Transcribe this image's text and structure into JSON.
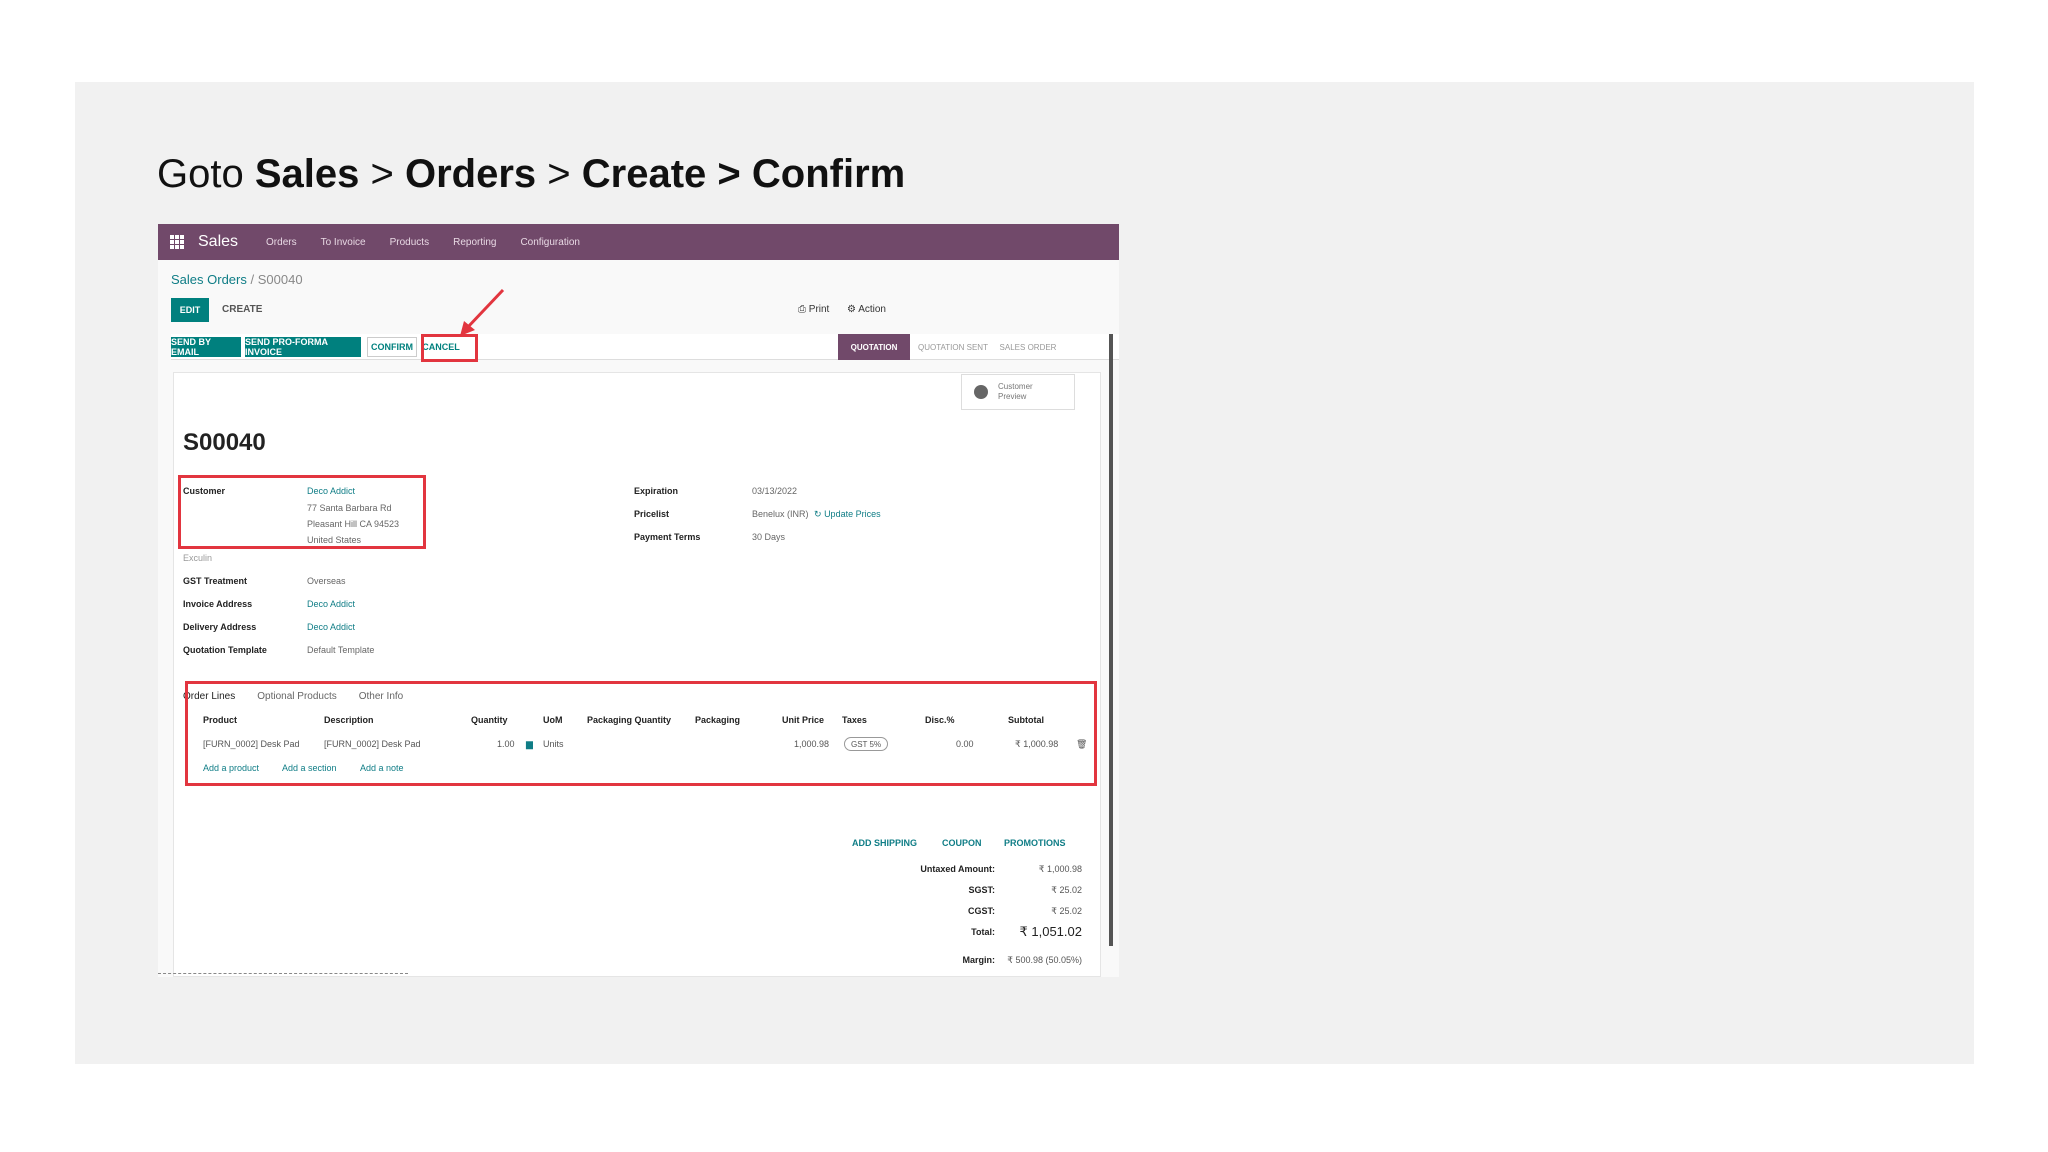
{
  "heading": {
    "goto": "Goto",
    "sales": "Sales",
    "sep1": ">",
    "orders": "Orders",
    "sep2": ">",
    "create": "Create",
    "sep3": ">",
    "confirm": "Confirm"
  },
  "app": {
    "title": "Sales",
    "nav": [
      "Orders",
      "To Invoice",
      "Products",
      "Reporting",
      "Configuration"
    ],
    "navbar_color": "#71496a",
    "accent_color": "#00807e"
  },
  "breadcrumb": {
    "parent": "Sales Orders",
    "sep": "/",
    "current": "S00040"
  },
  "control": {
    "edit": "EDIT",
    "create": "CREATE",
    "print": "⎙ Print",
    "action": "⚙ Action"
  },
  "statusbar": {
    "send_email": "SEND BY EMAIL",
    "send_proforma": "SEND PRO-FORMA INVOICE",
    "confirm": "CONFIRM",
    "cancel": "CANCEL",
    "stages": [
      "QUOTATION",
      "QUOTATION SENT",
      "SALES ORDER"
    ]
  },
  "preview": {
    "line1": "Customer",
    "line2": "Preview"
  },
  "order": {
    "name": "S00040",
    "customer_label": "Customer",
    "customer_name": "Deco Addict",
    "address_lines": [
      "77 Santa Barbara Rd",
      "Pleasant Hill CA 94523",
      "United States"
    ],
    "gstin": "Exculin",
    "gst_label": "GST Treatment",
    "gst_value": "Overseas",
    "invoice_label": "Invoice Address",
    "invoice_value": "Deco Addict",
    "delivery_label": "Delivery Address",
    "delivery_value": "Deco Addict",
    "template_label": "Quotation Template",
    "template_value": "Default Template",
    "expiration_label": "Expiration",
    "expiration_value": "03/13/2022",
    "pricelist_label": "Pricelist",
    "pricelist_value": "Benelux (INR)",
    "update_prices": "Update Prices",
    "terms_label": "Payment Terms",
    "terms_value": "30 Days"
  },
  "tabs": [
    "Order Lines",
    "Optional Products",
    "Other Info"
  ],
  "lines": {
    "headers": [
      "Product",
      "Description",
      "Quantity",
      "UoM",
      "Packaging Quantity",
      "Packaging",
      "Unit Price",
      "Taxes",
      "Disc.%",
      "Subtotal"
    ],
    "row": {
      "product": "[FURN_0002] Desk Pad",
      "description": "[FURN_0002] Desk Pad",
      "quantity": "1.00",
      "uom": "Units",
      "unit_price": "1,000.98",
      "taxes": "GST 5%",
      "discount": "0.00",
      "subtotal": "₹ 1,000.98"
    },
    "add_product": "Add a product",
    "add_section": "Add a section",
    "add_note": "Add a note"
  },
  "extras": {
    "shipping": "ADD SHIPPING",
    "coupon": "COUPON",
    "promotions": "PROMOTIONS"
  },
  "totals": {
    "untaxed_label": "Untaxed Amount:",
    "untaxed_value": "₹ 1,000.98",
    "sgst_label": "SGST:",
    "sgst_value": "₹ 25.02",
    "cgst_label": "CGST:",
    "cgst_value": "₹ 25.02",
    "total_label": "Total:",
    "total_value": "₹ 1,051.02",
    "margin_label": "Margin:",
    "margin_value": "₹ 500.98 (50.05%)"
  }
}
